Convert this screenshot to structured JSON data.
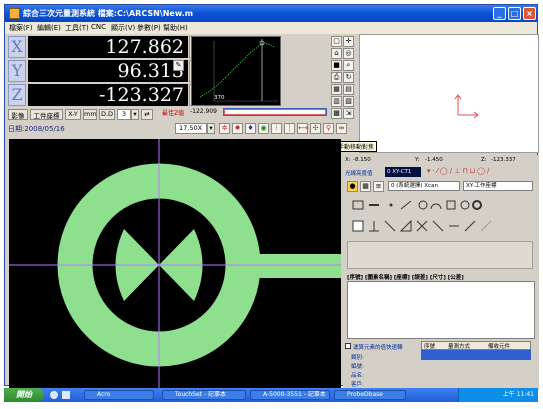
{
  "window": {
    "title": "綜合三次元量測系統    檔案:C:\\ARCSN\\New.m"
  },
  "menu": [
    "檔案(F)",
    "編輯(E)",
    "工具(T)",
    "CNC",
    "顯示(V)",
    "參數(P)",
    "幫助(H)"
  ],
  "dro": {
    "x_label": "X",
    "y_label": "Y",
    "z_label": "Z",
    "x_value": "127.862",
    "y_value": "96.313",
    "z_value": "-123.327"
  },
  "toolbar": {
    "image": "影像",
    "workcoord": "工件座標",
    "xy": "X-Y",
    "mm": "mm",
    "dd": "D.D",
    "dd_value": "3",
    "date": "日期:2008/05/16",
    "zoom": "17.50X",
    "max_z_label": "最佳Z值",
    "max_z_value": "-122.909",
    "profile_scale": "370"
  },
  "tooltip": "手動移動對焦",
  "right_panel": {
    "coords": {
      "x_label": "X:",
      "x": "-8.150",
      "y_label": "Y:",
      "y": "-1.450",
      "z_label": "Z:",
      "z": "-123.337"
    },
    "light_label": "光線亮度值",
    "light_value": "0 XY-CT1",
    "mode_select": "0 (系統選擇) Xcan",
    "coord_select": "XY-工作座標",
    "table_headers": [
      "[序號]",
      "[圖素名稱]",
      "[座標]",
      "[誤差]",
      "[尺寸]",
      "[公差]"
    ],
    "checkbox_label": "運算元素的值快速轉",
    "bottom_headers": [
      "序號",
      "量測方式",
      "備收元件"
    ],
    "fields": [
      "類別:",
      "編號:",
      "品名:",
      "客戶:"
    ]
  },
  "taskbar": {
    "start": "開始",
    "tasks": [
      "Acro",
      "TouchSet - 記事本",
      "A-5000-3551 - 記事本",
      "ProbeDbase"
    ],
    "clock": "上午 11:41"
  },
  "colors": {
    "dro_bg": "#000000",
    "dro_fg": "#ffffff",
    "target": "#8ee08e",
    "crosshair": "#b47cff",
    "title_bar": "#0a52d6"
  }
}
